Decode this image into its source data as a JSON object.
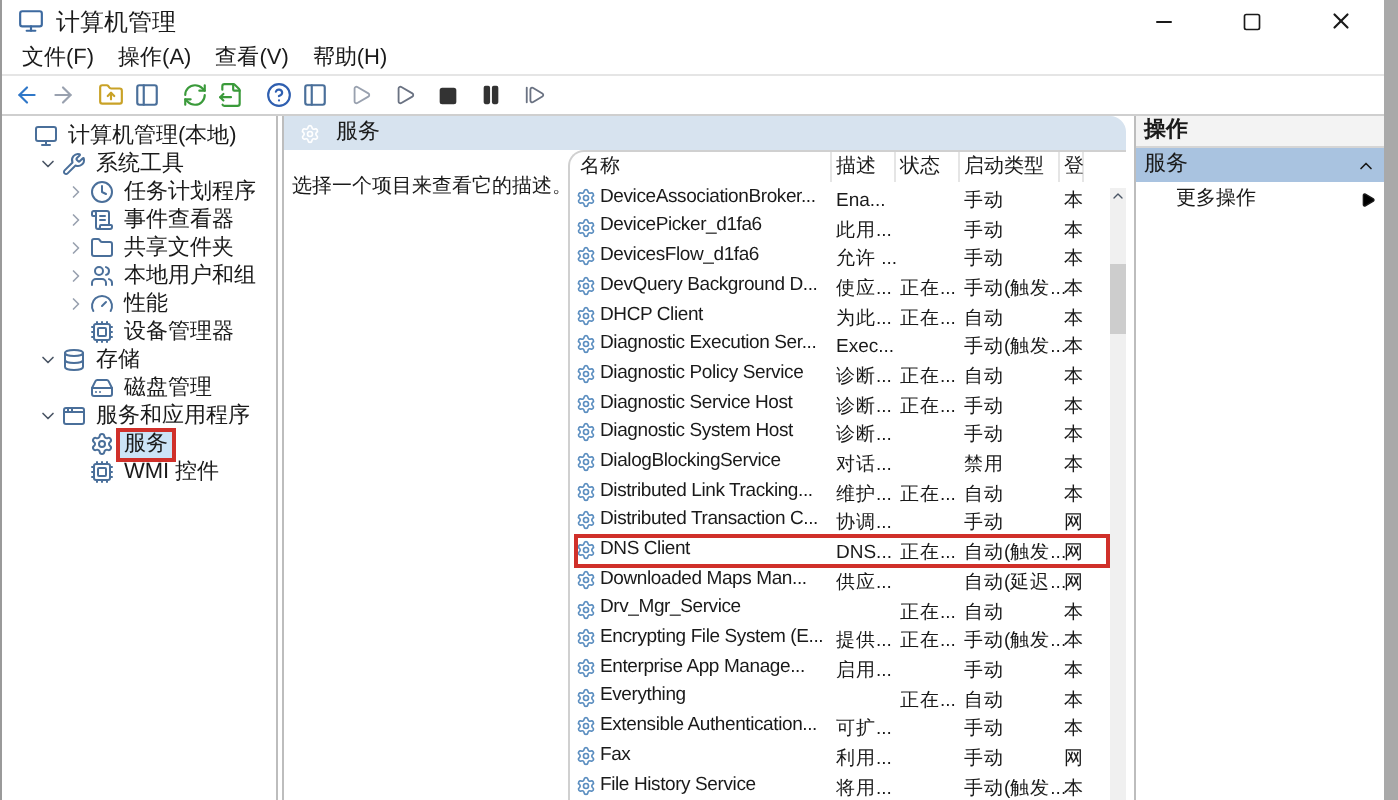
{
  "window": {
    "title": "计算机管理"
  },
  "menu": [
    "文件(F)",
    "操作(A)",
    "查看(V)",
    "帮助(H)"
  ],
  "tree": [
    {
      "label": "计算机管理(本地)",
      "kind": "leaf",
      "selected": false,
      "highlighted": false,
      "children": [
        {
          "label": "系统工具",
          "kind": "branch",
          "expanded": true,
          "selected": false,
          "highlighted": false,
          "children": [
            {
              "label": "任务计划程序",
              "kind": "branch",
              "expanded": false,
              "selected": false,
              "highlighted": false
            },
            {
              "label": "事件查看器",
              "kind": "branch",
              "expanded": false,
              "selected": false,
              "highlighted": false
            },
            {
              "label": "共享文件夹",
              "kind": "branch",
              "expanded": false,
              "selected": false,
              "highlighted": false
            },
            {
              "label": "本地用户和组",
              "kind": "branch",
              "expanded": false,
              "selected": false,
              "highlighted": false
            },
            {
              "label": "性能",
              "kind": "branch",
              "expanded": false,
              "selected": false,
              "highlighted": false
            },
            {
              "label": "设备管理器",
              "kind": "leaf",
              "selected": false,
              "highlighted": false
            }
          ]
        },
        {
          "label": "存储",
          "kind": "branch",
          "expanded": true,
          "selected": false,
          "highlighted": false,
          "children": [
            {
              "label": "磁盘管理",
              "kind": "leaf",
              "selected": false,
              "highlighted": false
            }
          ]
        },
        {
          "label": "服务和应用程序",
          "kind": "branch",
          "expanded": true,
          "selected": false,
          "highlighted": false,
          "children": [
            {
              "label": "服务",
              "kind": "leaf",
              "selected": true,
              "highlighted": true
            },
            {
              "label": "WMI 控件",
              "kind": "leaf",
              "selected": false,
              "highlighted": false
            }
          ]
        }
      ]
    }
  ],
  "center": {
    "header": "服务",
    "description": "选择一个项目来查看它的描述。"
  },
  "table": {
    "columns": [
      "名称",
      "描述",
      "状态",
      "启动类型",
      "登"
    ],
    "rows": [
      {
        "cells": [
          "DeviceAssociationBroker...",
          "Ena...",
          "",
          "手动",
          "本"
        ],
        "highlighted": false
      },
      {
        "cells": [
          "DevicePicker_d1fa6",
          "此用...",
          "",
          "手动",
          "本"
        ],
        "highlighted": false
      },
      {
        "cells": [
          "DevicesFlow_d1fa6",
          "允许 ...",
          "",
          "手动",
          "本"
        ],
        "highlighted": false
      },
      {
        "cells": [
          "DevQuery Background D...",
          "使应...",
          "正在...",
          "手动(触发...",
          "本"
        ],
        "highlighted": false
      },
      {
        "cells": [
          "DHCP Client",
          "为此...",
          "正在...",
          "自动",
          "本"
        ],
        "highlighted": false
      },
      {
        "cells": [
          "Diagnostic Execution Ser...",
          "Exec...",
          "",
          "手动(触发...",
          "本"
        ],
        "highlighted": false
      },
      {
        "cells": [
          "Diagnostic Policy Service",
          "诊断...",
          "正在...",
          "自动",
          "本"
        ],
        "highlighted": false
      },
      {
        "cells": [
          "Diagnostic Service Host",
          "诊断...",
          "正在...",
          "手动",
          "本"
        ],
        "highlighted": false
      },
      {
        "cells": [
          "Diagnostic System Host",
          "诊断...",
          "",
          "手动",
          "本"
        ],
        "highlighted": false
      },
      {
        "cells": [
          "DialogBlockingService",
          "对话...",
          "",
          "禁用",
          "本"
        ],
        "highlighted": false
      },
      {
        "cells": [
          "Distributed Link Tracking...",
          "维护...",
          "正在...",
          "自动",
          "本"
        ],
        "highlighted": false
      },
      {
        "cells": [
          "Distributed Transaction C...",
          "协调...",
          "",
          "手动",
          "网"
        ],
        "highlighted": false
      },
      {
        "cells": [
          "DNS Client",
          "DNS...",
          "正在...",
          "自动(触发...",
          "网"
        ],
        "highlighted": true
      },
      {
        "cells": [
          "Downloaded Maps Man...",
          "供应...",
          "",
          "自动(延迟...",
          "网"
        ],
        "highlighted": false
      },
      {
        "cells": [
          "Drv_Mgr_Service",
          "",
          "正在...",
          "自动",
          "本"
        ],
        "highlighted": false
      },
      {
        "cells": [
          "Encrypting File System (E...",
          "提供...",
          "正在...",
          "手动(触发...",
          "本"
        ],
        "highlighted": false
      },
      {
        "cells": [
          "Enterprise App Manage...",
          "启用...",
          "",
          "手动",
          "本"
        ],
        "highlighted": false
      },
      {
        "cells": [
          "Everything",
          "",
          "正在...",
          "自动",
          "本"
        ],
        "highlighted": false
      },
      {
        "cells": [
          "Extensible Authentication...",
          "可扩...",
          "",
          "手动",
          "本"
        ],
        "highlighted": false
      },
      {
        "cells": [
          "Fax",
          "利用...",
          "",
          "手动",
          "网"
        ],
        "highlighted": false
      },
      {
        "cells": [
          "File History Service",
          "将用...",
          "",
          "手动(触发...",
          "本"
        ],
        "highlighted": false
      }
    ]
  },
  "actions": {
    "title": "操作",
    "section": {
      "label": "服务",
      "expanded": true
    },
    "items": [
      "更多操作"
    ]
  }
}
